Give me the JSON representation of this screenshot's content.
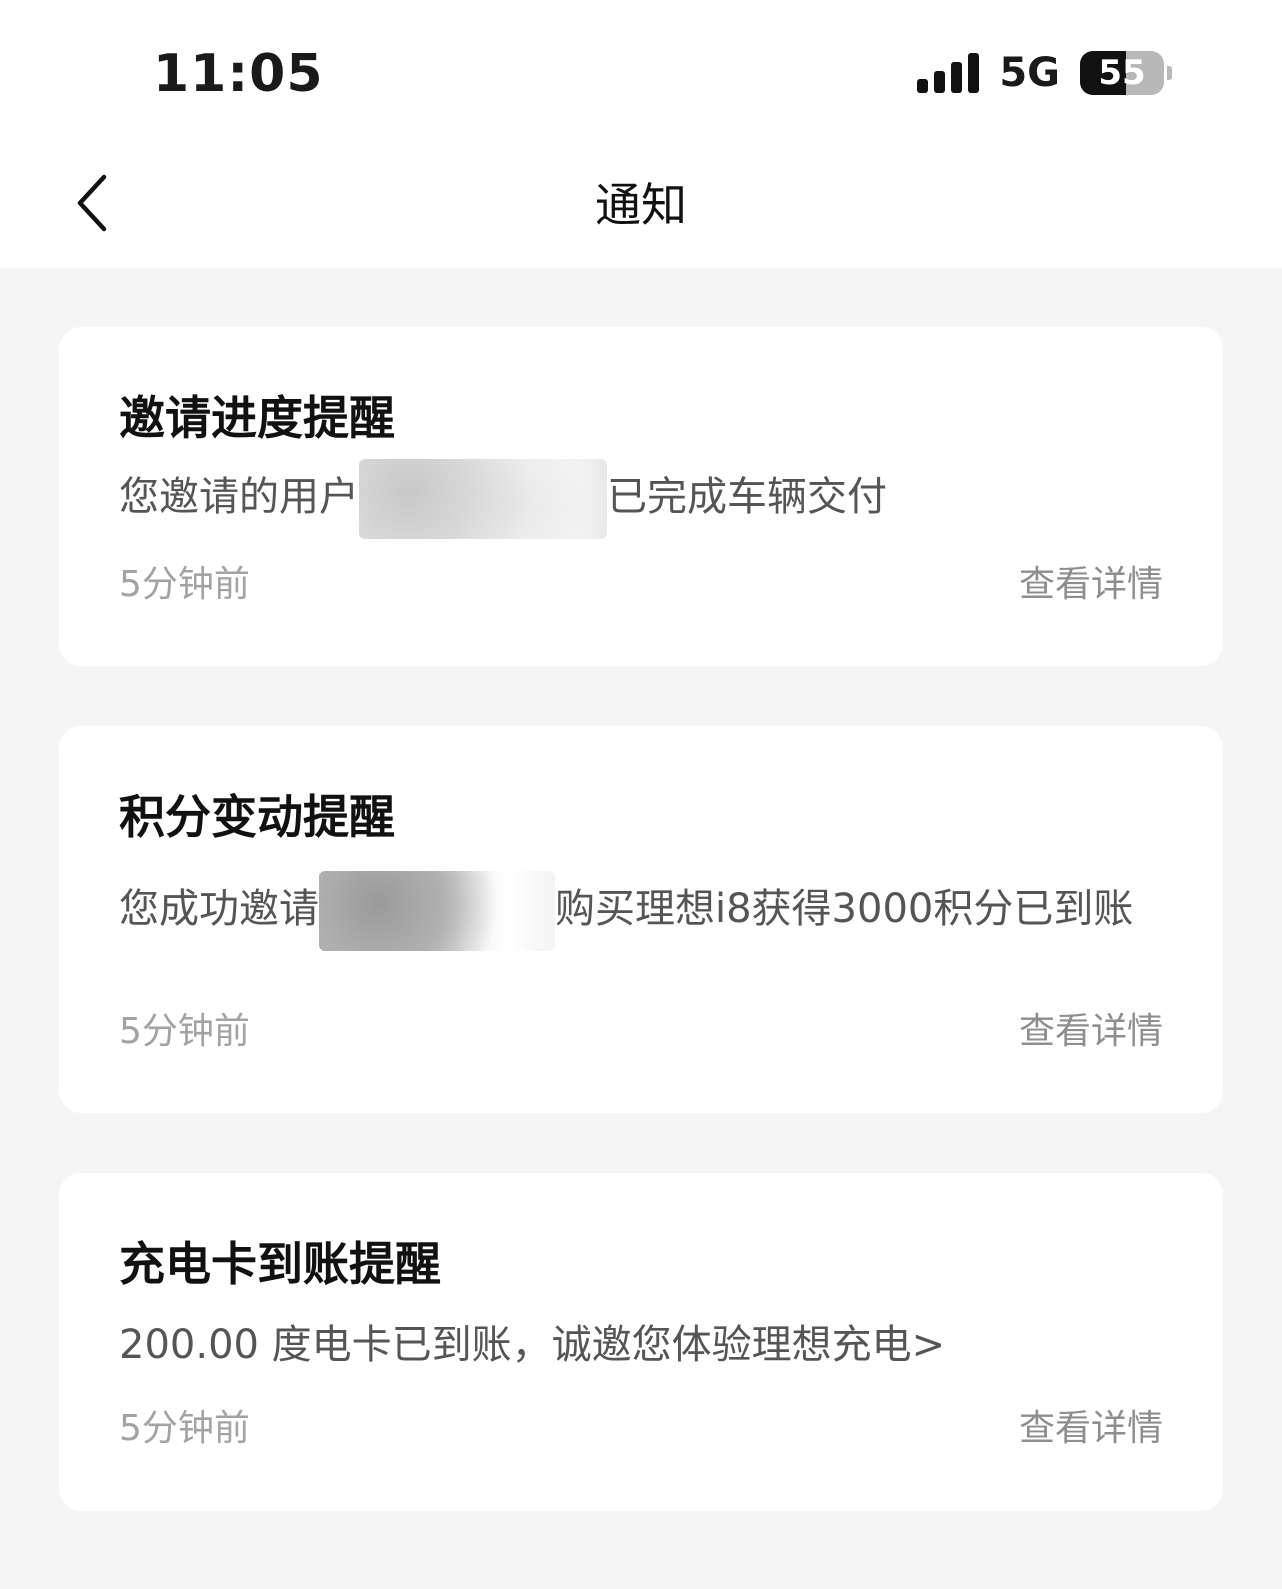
{
  "status_bar": {
    "time": "11:05",
    "network": "5G",
    "battery_level": "55",
    "battery_fraction": 0.55
  },
  "nav": {
    "title": "通知"
  },
  "notifications": [
    {
      "title": "邀请进度提醒",
      "body_before": "您邀请的用户",
      "body_after": "已完成车辆交付",
      "time": "5分钟前",
      "detail_label": "查看详情"
    },
    {
      "title": "积分变动提醒",
      "body_before": "您成功邀请",
      "body_after": "购买理想i8获得3000积分已到账",
      "time": "5分钟前",
      "detail_label": "查看详情"
    },
    {
      "title": "充电卡到账提醒",
      "body": "200.00 度电卡已到账，诚邀您体验理想充电>",
      "time": "5分钟前",
      "detail_label": "查看详情"
    }
  ]
}
